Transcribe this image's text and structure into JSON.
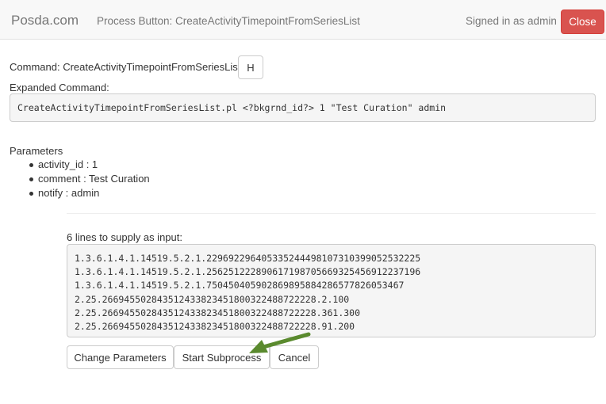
{
  "navbar": {
    "brand": "Posda.com",
    "title": "Process Button: CreateActivityTimepointFromSeriesList",
    "signed_in": "Signed in as admin",
    "close_label": "Close"
  },
  "command": {
    "label": "Command: CreateActivityTimepointFromSeriesList",
    "h_button": "H",
    "expanded_label": "Expanded Command:",
    "expanded_text": "CreateActivityTimepointFromSeriesList.pl <?bkgrnd_id?> 1 \"Test Curation\" admin"
  },
  "parameters": {
    "heading": "Parameters",
    "items": [
      "activity_id : 1",
      "comment : Test Curation",
      "notify : admin"
    ]
  },
  "input": {
    "label": "6 lines to supply as input:",
    "lines": [
      "1.3.6.1.4.1.14519.5.2.1.229692296405335244498107310399052532225",
      "1.3.6.1.4.1.14519.5.2.1.256251222890617198705669325456912237196",
      "1.3.6.1.4.1.14519.5.2.1.750450405902869895884286577826053467",
      "2.25.266945502843512433823451800322488722228.2.100",
      "2.25.266945502843512433823451800322488722228.361.300",
      "2.25.266945502843512433823451800322488722228.91.200"
    ]
  },
  "actions": {
    "change_parameters": "Change Parameters",
    "start_subprocess": "Start Subprocess",
    "cancel": "Cancel"
  },
  "colors": {
    "close_button": "#d9534f",
    "arrow": "#5a8a2e"
  }
}
